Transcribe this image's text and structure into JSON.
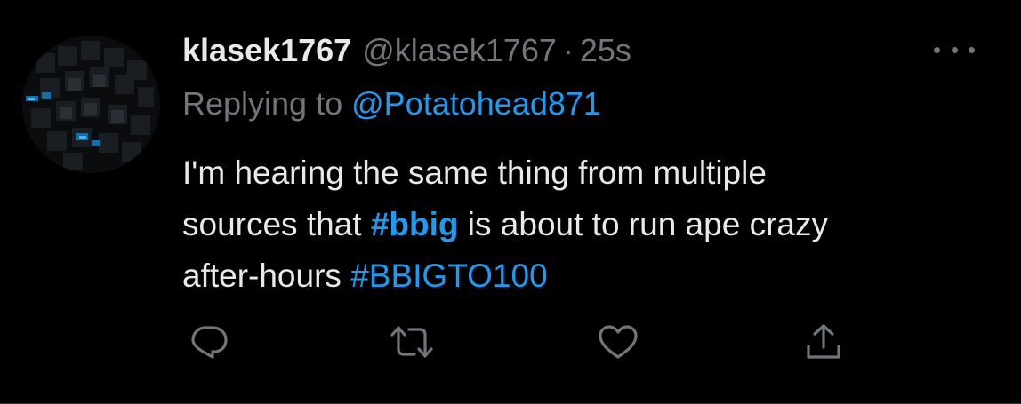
{
  "tweet": {
    "author_name": "klasek1767",
    "author_handle": "@klasek1767",
    "separator": "·",
    "timestamp": "25s",
    "reply_prefix": "Replying to",
    "reply_target": "@Potatohead871",
    "body": {
      "line1": "I'm hearing the same thing from multiple",
      "line2_pre": "sources that",
      "line2_hashtag": "#bbig",
      "line2_post": "is about to run ape crazy",
      "line3_pre": "after-hours",
      "line3_hashtag": "#BBIGTO100"
    },
    "more_menu_icon": "more-horizontal-icon",
    "actions": [
      {
        "name": "reply",
        "icon": "reply-icon"
      },
      {
        "name": "retweet",
        "icon": "retweet-icon"
      },
      {
        "name": "like",
        "icon": "heart-icon"
      },
      {
        "name": "share",
        "icon": "share-icon"
      }
    ]
  },
  "colors": {
    "background": "#000000",
    "text_primary": "#e7e9ea",
    "text_secondary": "#71767b",
    "accent": "#1d9bf0"
  }
}
